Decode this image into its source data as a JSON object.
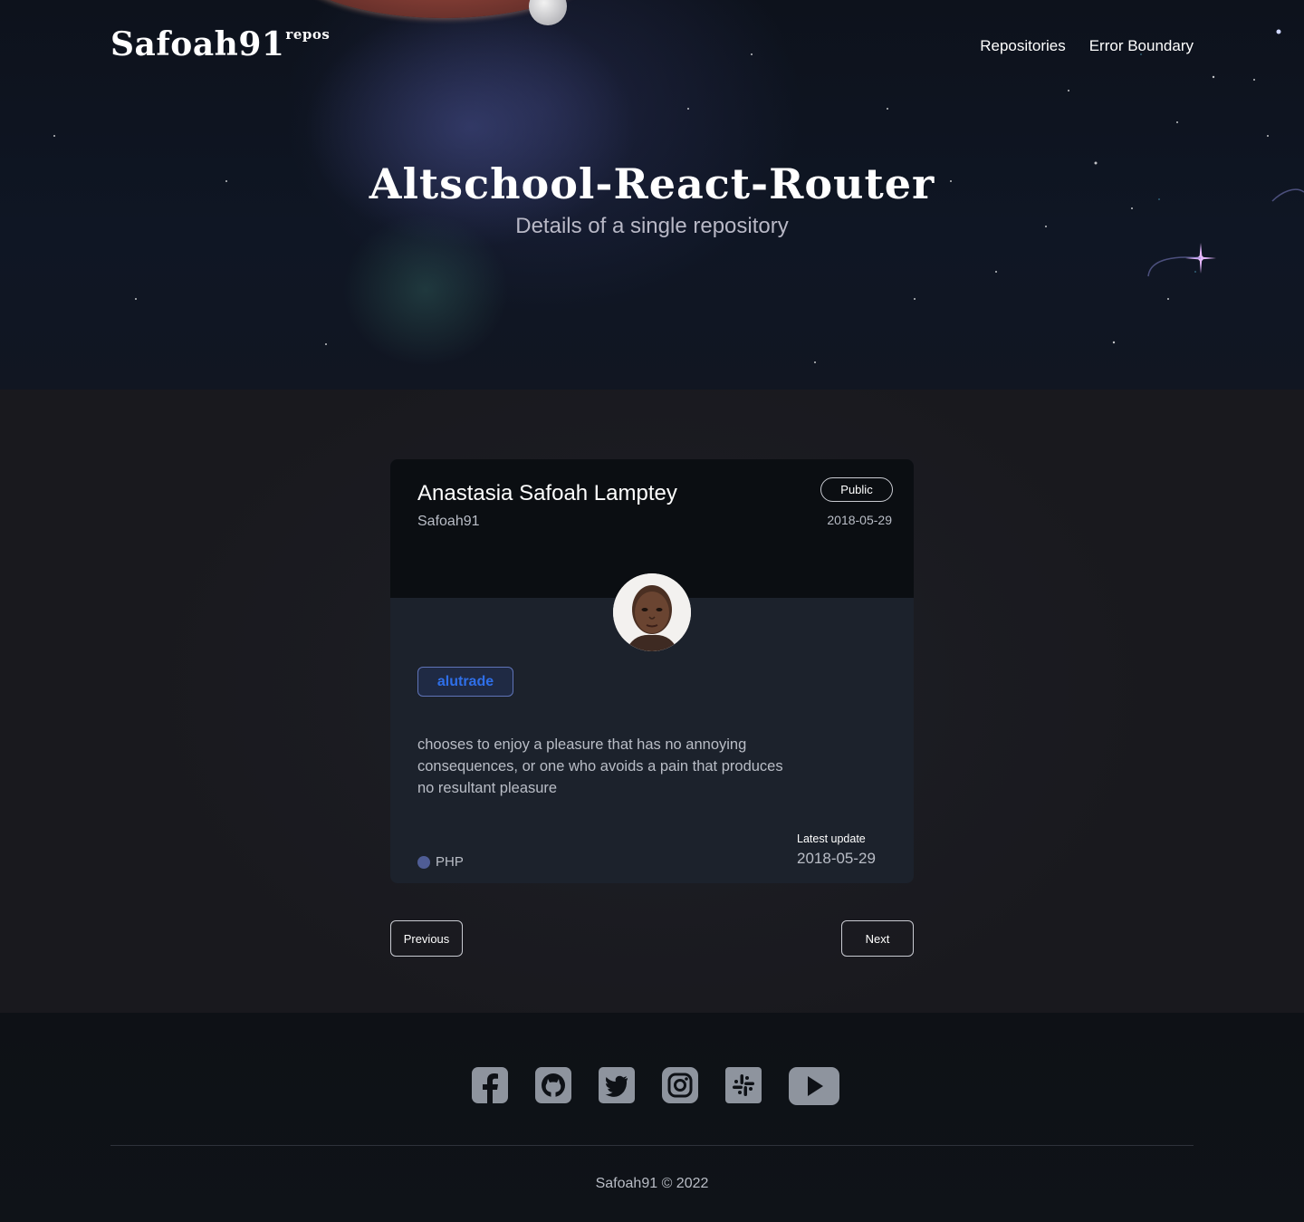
{
  "header": {
    "logo": "Safoah91",
    "logo_sup": "repos",
    "nav": [
      "Repositories",
      "Error Boundary"
    ]
  },
  "hero": {
    "title": "Altschool-React-Router",
    "subtitle": "Details of a single repository"
  },
  "repo": {
    "owner_name": "Anastasia Safoah Lamptey",
    "owner_login": "Safoah91",
    "visibility": "Public",
    "created": "2018-05-29",
    "name": "alutrade",
    "description": "chooses to enjoy a pleasure that has no annoying consequences, or one who avoids a pain that produces no resultant pleasure",
    "language": "PHP",
    "language_color": "#4F5D95",
    "update_label": "Latest update",
    "updated": "2018-05-29"
  },
  "pagination": {
    "previous": "Previous",
    "next": "Next"
  },
  "footer": {
    "socials": [
      "facebook-icon",
      "github-icon",
      "twitter-icon",
      "instagram-icon",
      "slack-icon",
      "youtube-icon"
    ],
    "copyright": "Safoah91 © 2022"
  },
  "colors": {
    "accent": "#2F6FE8",
    "card_bg": "#1C222C",
    "icon": "#8E949E"
  }
}
